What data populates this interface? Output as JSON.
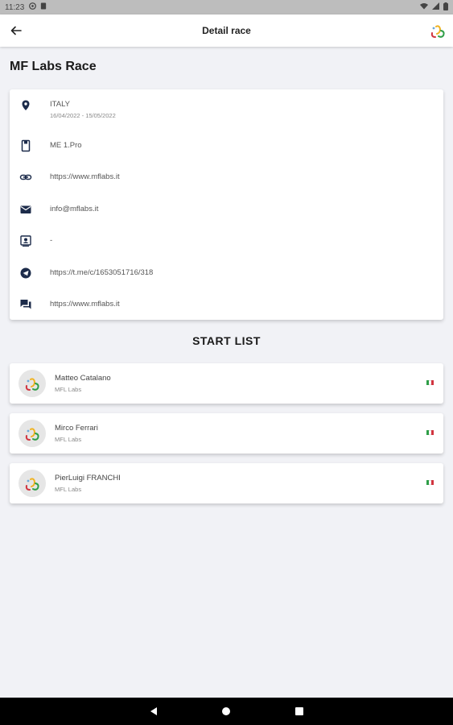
{
  "status_bar": {
    "time": "11:23"
  },
  "app_bar": {
    "title": "Detail race"
  },
  "race": {
    "name": "MF Labs Race",
    "location": "ITALY",
    "dates": "16/04/2022 - 15/05/2022",
    "series": "ME 1.Pro",
    "website": "https://www.mflabs.it",
    "email": "info@mflabs.it",
    "contact": "-",
    "telegram": "https://t.me/c/1653051716/318",
    "chat": "https://www.mflabs.it"
  },
  "start_list": {
    "title": "START LIST",
    "athletes": [
      {
        "name": "Matteo Catalano",
        "team": "MFL Labs"
      },
      {
        "name": "Mirco Ferrari",
        "team": "MFL Labs"
      },
      {
        "name": "PierLuigi FRANCHI",
        "team": "MFL Labs"
      }
    ]
  },
  "colors": {
    "flag_green": "#2e9e47",
    "flag_white": "#ffffff",
    "flag_red": "#d1343f",
    "accent": "#1a1a1a"
  },
  "icons": [
    "location-pin-icon",
    "badge-icon",
    "link-icon",
    "mail-icon",
    "contact-icon",
    "telegram-icon",
    "chat-icon"
  ]
}
